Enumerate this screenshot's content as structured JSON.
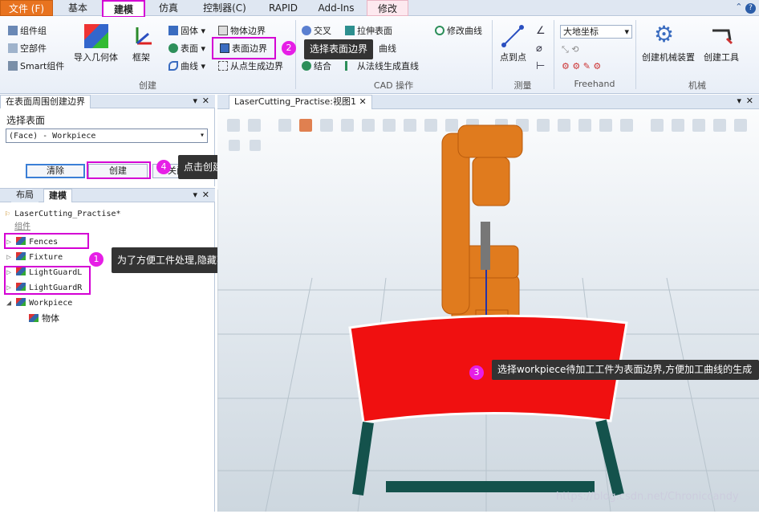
{
  "tabs": [
    "文件 (F)",
    "基本",
    "建模",
    "仿真",
    "控制器(C)",
    "RAPID",
    "Add-Ins",
    "修改"
  ],
  "ribbon": {
    "col1": [
      "组件组",
      "空部件",
      "Smart组件"
    ],
    "import_geom": "导入几何体",
    "frame": "框架",
    "col3": [
      "固体",
      "表面",
      "曲线"
    ],
    "col4": [
      "物体边界",
      "表面边界",
      "从点生成边界"
    ],
    "col5": [
      "交叉",
      "拉伸表面",
      "结合"
    ],
    "col5b": [
      "曲线",
      "从法线生成直线"
    ],
    "modify_curve": "修改曲线",
    "point_to_point": "点到点",
    "freehand_select": "大地坐标",
    "create_mech": "创建机械装置",
    "create_tool": "创建工具",
    "groups": [
      "创建",
      "CAD 操作",
      "测量",
      "Freehand",
      "机械"
    ]
  },
  "panel": {
    "title": "在表面周围创建边界",
    "select_label": "选择表面",
    "select_value": "(Face) - Workpiece",
    "clear": "清除",
    "create": "创建",
    "close": "关闭"
  },
  "layout_tabs": [
    "布局",
    "建模"
  ],
  "tree": {
    "root": "LaserCutting_Practise*",
    "group": "组件",
    "items": [
      "Fences",
      "Fixture",
      "LightGuardL",
      "LightGuardR",
      "Workpiece"
    ],
    "body": "物体"
  },
  "viewport_title": "LaserCutting_Practise:视图1",
  "annotations": {
    "a1": "为了方便工件处理,隐藏不必要的部件",
    "a2": "选择表面边界",
    "a3": "选择workpiece待加工工件为表面边界,方便加工曲线的生成",
    "a4": "点击创建",
    "n1": "1",
    "n2": "2",
    "n3": "3",
    "n4": "4"
  },
  "watermark": "https://blog.csdn.net/Chroniccandy",
  "colors": {
    "accent": "#d400d4",
    "robot": "#e07b1e",
    "workpiece": "#f01010"
  }
}
